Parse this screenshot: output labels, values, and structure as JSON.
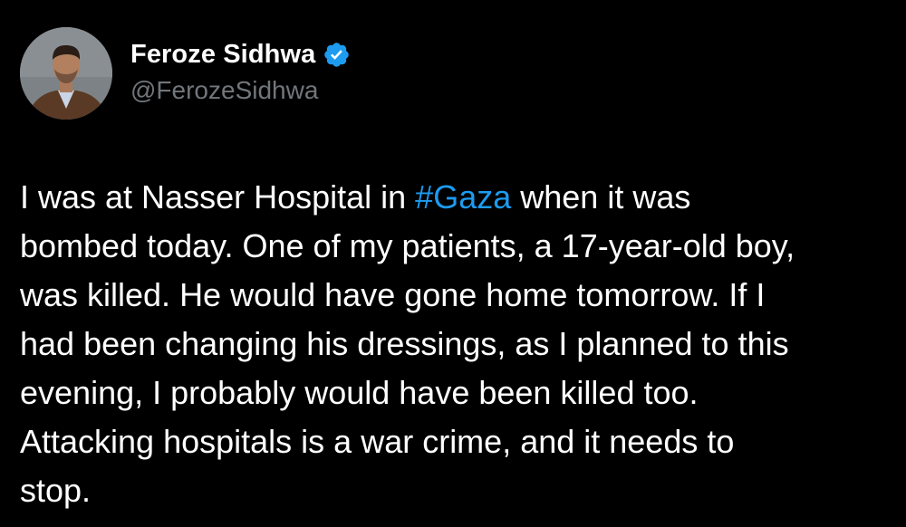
{
  "author": {
    "display_name": "Feroze Sidhwa",
    "handle": "@FerozeSidhwa",
    "verified_icon": "verified-badge-icon",
    "avatar": "profile-photo"
  },
  "tweet": {
    "lines": [
      {
        "before": "I was at Nasser Hospital in ",
        "hashtag": "#Gaza",
        "after": " when it was"
      },
      {
        "text": "bombed today. One of my patients, a 17-year-old boy,"
      },
      {
        "text": "was killed. He would have gone home tomorrow. If I"
      },
      {
        "text": "had been changing his dressings, as I planned to this"
      },
      {
        "text": "evening, I probably would have been killed too."
      },
      {
        "text": "Attacking hospitals is a war crime, and it needs to"
      },
      {
        "text": "stop."
      }
    ]
  },
  "colors": {
    "background": "#000000",
    "text": "#ffffff",
    "secondary_text": "#71767b",
    "accent": "#1d9bf0"
  }
}
